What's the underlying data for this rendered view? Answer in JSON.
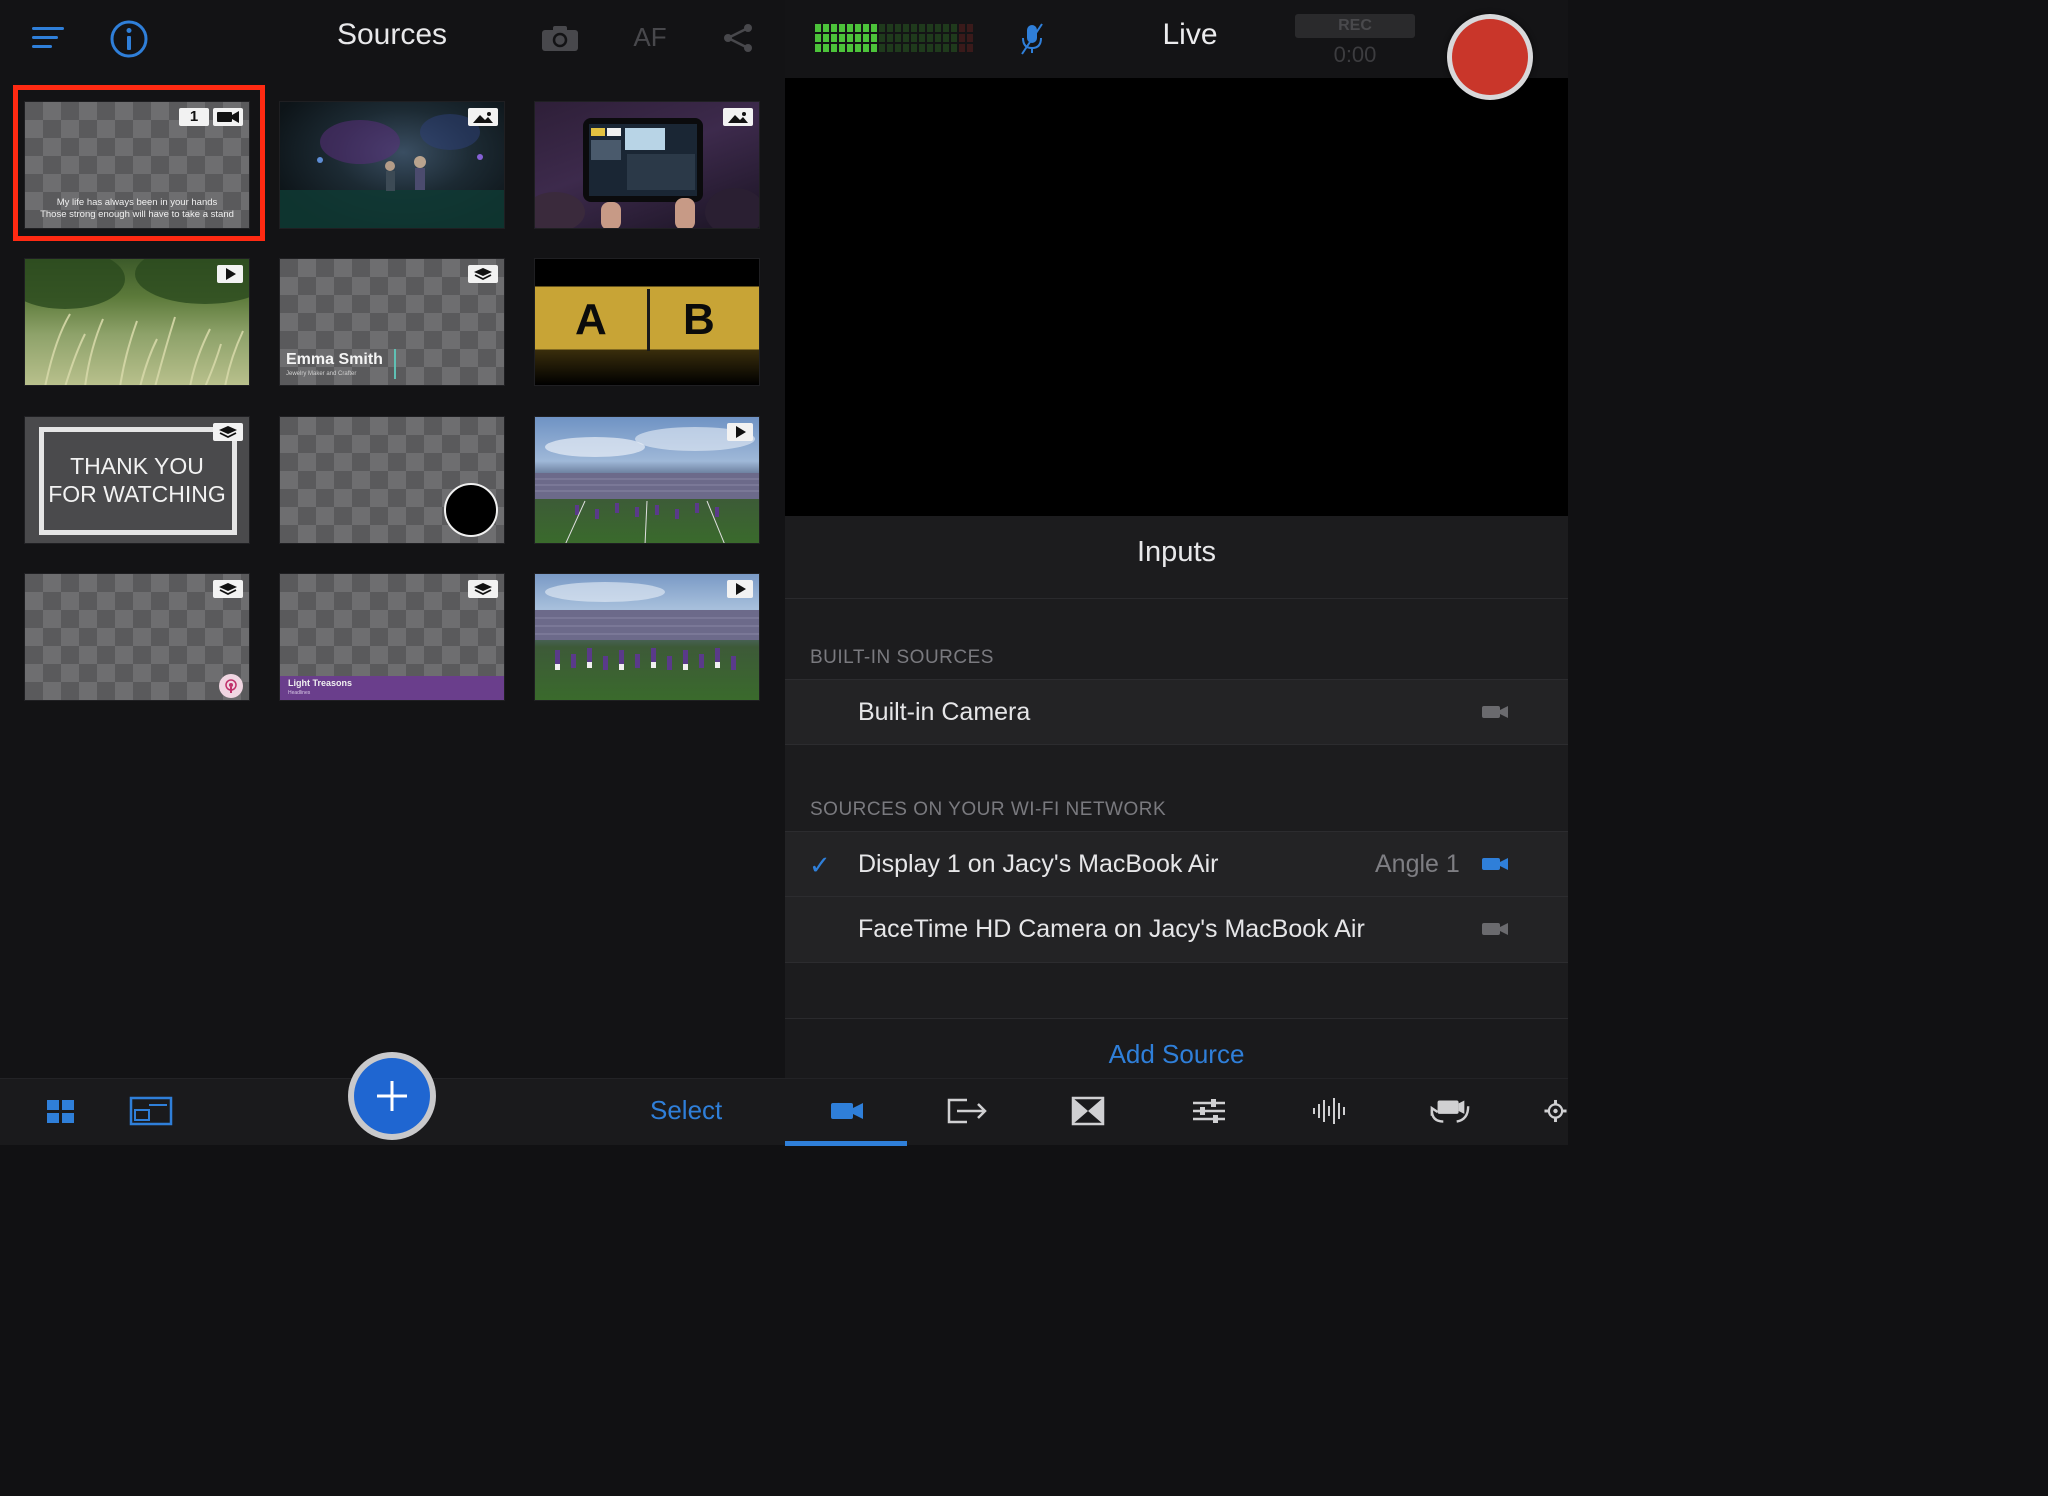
{
  "left": {
    "title": "Sources",
    "af_label": "AF",
    "select_label": "Select",
    "tiles": [
      {
        "kind": "camera",
        "badge_number": "1",
        "lyric_line1": "My life has always been in your hands",
        "lyric_line2": "Those strong enough will have to take a stand"
      },
      {
        "kind": "image"
      },
      {
        "kind": "image"
      },
      {
        "kind": "video"
      },
      {
        "kind": "layer",
        "name": "Emma Smith",
        "subtitle": "Jewelry Maker and Crafter"
      },
      {
        "kind": "ab",
        "letter_a": "A",
        "letter_b": "B"
      },
      {
        "kind": "layer",
        "line1": "THANK YOU",
        "line2": "FOR WATCHING"
      },
      {
        "kind": "blank"
      },
      {
        "kind": "video"
      },
      {
        "kind": "layer"
      },
      {
        "kind": "layer",
        "lower_third": "Light Treasons",
        "lower_third_sub": "Headlines"
      },
      {
        "kind": "video"
      }
    ]
  },
  "right": {
    "title": "Live",
    "rec_label": "REC",
    "rec_time": "0:00",
    "inputs_title": "Inputs",
    "builtin_header": "BUILT-IN SOURCES",
    "builtin_items": [
      {
        "label": "Built-in Camera"
      }
    ],
    "network_header": "SOURCES ON YOUR WI-FI NETWORK",
    "network_items": [
      {
        "label": "Display 1 on Jacy's MacBook Air",
        "checked": "✓",
        "angle": "Angle 1"
      },
      {
        "label": "FaceTime HD Camera on Jacy's MacBook Air"
      }
    ],
    "add_source": "Add Source"
  },
  "colors": {
    "accent": "#2f7fd9",
    "record": "#c9362a",
    "selection": "#ff2a12",
    "meter_green": "#4cc33a"
  }
}
